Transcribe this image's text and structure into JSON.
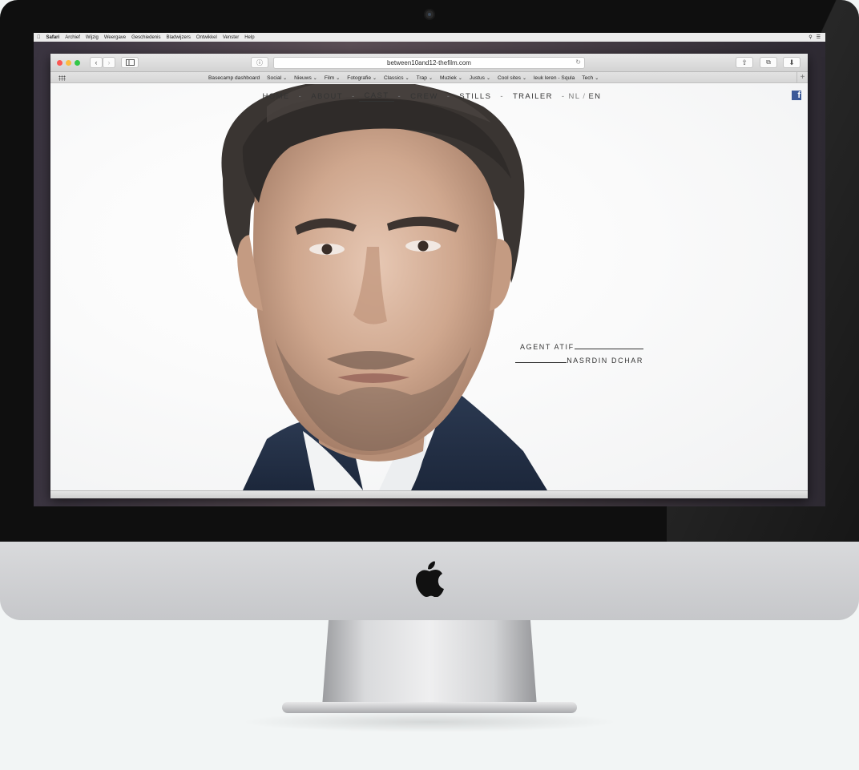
{
  "menubar": {
    "items": [
      "Safari",
      "Archief",
      "Wijzig",
      "Weergave",
      "Geschiedenis",
      "Bladwijzers",
      "Ontwikkel",
      "Venster",
      "Help"
    ]
  },
  "browser": {
    "url": "between10and12-thefilm.com",
    "bookmarks": [
      {
        "label": "Basecamp dashboard",
        "menu": false
      },
      {
        "label": "Social",
        "menu": true
      },
      {
        "label": "Nieuws",
        "menu": true
      },
      {
        "label": "Film",
        "menu": true
      },
      {
        "label": "Fotografie",
        "menu": true
      },
      {
        "label": "Classics",
        "menu": true
      },
      {
        "label": "Trap",
        "menu": true
      },
      {
        "label": "Muziek",
        "menu": true
      },
      {
        "label": "Justus",
        "menu": true
      },
      {
        "label": "Cool sites",
        "menu": true
      },
      {
        "label": "leuk leren - Squla",
        "menu": false
      },
      {
        "label": "Tech",
        "menu": true
      }
    ]
  },
  "site": {
    "nav": {
      "home": "HOME",
      "about": "ABOUT",
      "cast": "CAST",
      "crew": "CREW",
      "stills": "STILLS",
      "trailer": "TRAILER",
      "sep": "-",
      "lang_nl": "NL",
      "lang_slash": "/",
      "lang_en": "EN"
    },
    "facebook_glyph": "f",
    "caption": {
      "role": "AGENT ATIF",
      "actor": "NASRDIN DCHAR"
    }
  },
  "colors": {
    "accent_facebook": "#3b5998",
    "nav_text": "#333333"
  }
}
